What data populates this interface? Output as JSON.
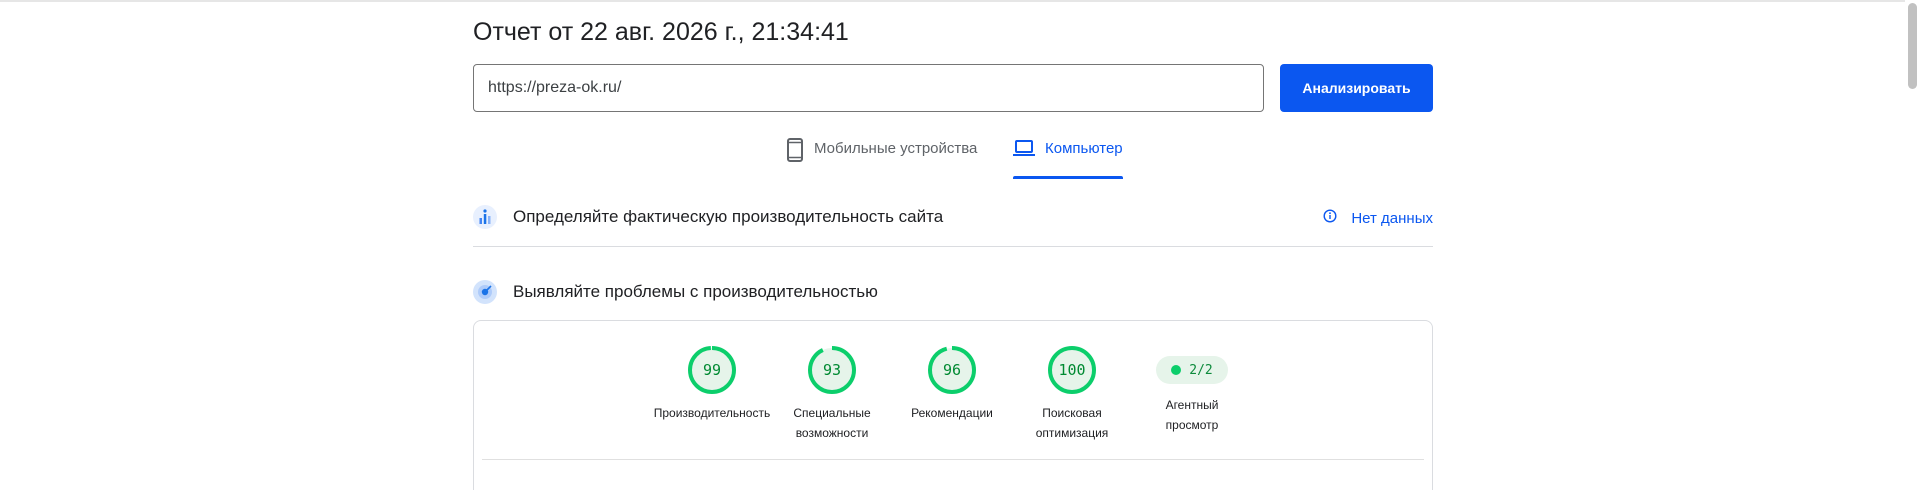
{
  "report": {
    "title": "Отчет от 22 авг. 2026 г., 21:34:41"
  },
  "search": {
    "url_value": "https://preza-ok.ru/",
    "analyze_label": "Анализировать"
  },
  "tabs": [
    {
      "label": "Мобильные устройства",
      "icon": "smartphone-icon",
      "active": false
    },
    {
      "label": "Компьютер",
      "icon": "laptop-icon",
      "active": true
    }
  ],
  "field_data": {
    "title": "Определяйте фактическую производительность сайта",
    "status": "Нет данных",
    "icon": "field-data-icon",
    "status_icon": "info-icon"
  },
  "lab_data": {
    "title": "Выявляйте проблемы с производительностью",
    "icon": "lab-data-icon"
  },
  "scores": [
    {
      "value": "99",
      "percent": 99,
      "label_line1": "Производительность",
      "label_line2": ""
    },
    {
      "value": "93",
      "percent": 93,
      "label_line1": "Специальные",
      "label_line2": "возможности"
    },
    {
      "value": "96",
      "percent": 96,
      "label_line1": "Рекомендации",
      "label_line2": ""
    },
    {
      "value": "100",
      "percent": 100,
      "label_line1": "Поисковая",
      "label_line2": "оптимизация"
    }
  ],
  "agent": {
    "value": "2/2",
    "label_line1": "Агентный",
    "label_line2": "просмотр"
  },
  "colors": {
    "accent": "#0b57f0",
    "pass": "#0cce6b",
    "pass_text": "#008a32",
    "pass_bg": "#e6f4ea"
  }
}
